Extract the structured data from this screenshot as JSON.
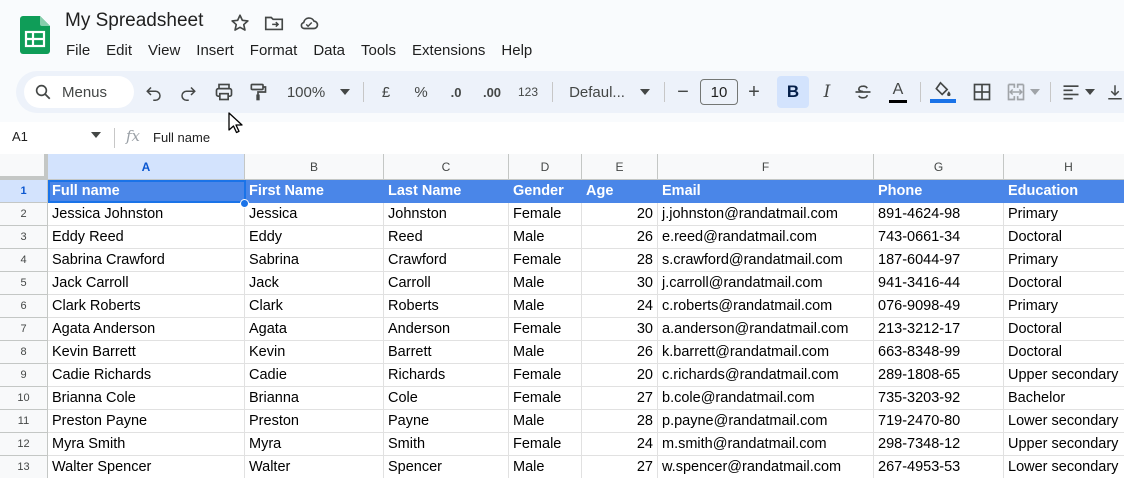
{
  "app": {
    "title": "My Spreadsheet"
  },
  "menu": [
    "File",
    "Edit",
    "View",
    "Insert",
    "Format",
    "Data",
    "Tools",
    "Extensions",
    "Help"
  ],
  "toolbar": {
    "menus_label": "Menus",
    "zoom": "100%",
    "currency": "£",
    "percent": "%",
    "decrease_decimal": ".0",
    "increase_decimal": ".00",
    "number_format": "123",
    "font": "Defaul...",
    "font_size": "10",
    "bold": "B",
    "italic": "I",
    "text_color": "A",
    "minus": "−",
    "plus": "+"
  },
  "formula_bar": {
    "name_box": "A1",
    "fx": "fx",
    "value": "Full name"
  },
  "columns": [
    "A",
    "B",
    "C",
    "D",
    "E",
    "F",
    "G",
    "H"
  ],
  "rows": [
    {
      "n": "1",
      "cells": [
        "Full name",
        "First Name",
        "Last Name",
        "Gender",
        "Age",
        "Email",
        "Phone",
        "Education"
      ]
    },
    {
      "n": "2",
      "cells": [
        "Jessica Johnston",
        "Jessica",
        "Johnston",
        "Female",
        "20",
        "j.johnston@randatmail.com",
        "891-4624-98",
        "Primary"
      ]
    },
    {
      "n": "3",
      "cells": [
        "Eddy Reed",
        "Eddy",
        "Reed",
        "Male",
        "26",
        "e.reed@randatmail.com",
        "743-0661-34",
        "Doctoral"
      ]
    },
    {
      "n": "4",
      "cells": [
        "Sabrina Crawford",
        "Sabrina",
        "Crawford",
        "Female",
        "28",
        "s.crawford@randatmail.com",
        "187-6044-97",
        "Primary"
      ]
    },
    {
      "n": "5",
      "cells": [
        "Jack Carroll",
        "Jack",
        "Carroll",
        "Male",
        "30",
        "j.carroll@randatmail.com",
        "941-3416-44",
        "Doctoral"
      ]
    },
    {
      "n": "6",
      "cells": [
        "Clark Roberts",
        "Clark",
        "Roberts",
        "Male",
        "24",
        "c.roberts@randatmail.com",
        "076-9098-49",
        "Primary"
      ]
    },
    {
      "n": "7",
      "cells": [
        "Agata Anderson",
        "Agata",
        "Anderson",
        "Female",
        "30",
        "a.anderson@randatmail.com",
        "213-3212-17",
        "Doctoral"
      ]
    },
    {
      "n": "8",
      "cells": [
        "Kevin Barrett",
        "Kevin",
        "Barrett",
        "Male",
        "26",
        "k.barrett@randatmail.com",
        "663-8348-99",
        "Doctoral"
      ]
    },
    {
      "n": "9",
      "cells": [
        "Cadie Richards",
        "Cadie",
        "Richards",
        "Female",
        "20",
        "c.richards@randatmail.com",
        "289-1808-65",
        "Upper secondary"
      ]
    },
    {
      "n": "10",
      "cells": [
        "Brianna Cole",
        "Brianna",
        "Cole",
        "Female",
        "27",
        "b.cole@randatmail.com",
        "735-3203-92",
        "Bachelor"
      ]
    },
    {
      "n": "11",
      "cells": [
        "Preston Payne",
        "Preston",
        "Payne",
        "Male",
        "28",
        "p.payne@randatmail.com",
        "719-2470-80",
        "Lower secondary"
      ]
    },
    {
      "n": "12",
      "cells": [
        "Myra Smith",
        "Myra",
        "Smith",
        "Female",
        "24",
        "m.smith@randatmail.com",
        "298-7348-12",
        "Upper secondary"
      ]
    },
    {
      "n": "13",
      "cells": [
        "Walter Spencer",
        "Walter",
        "Spencer",
        "Male",
        "27",
        "w.spencer@randatmail.com",
        "267-4953-53",
        "Lower secondary"
      ]
    }
  ],
  "colors": {
    "header_fill": "#4a86e8",
    "selection": "#1a73e8",
    "sheets_green": "#0f9d58"
  }
}
